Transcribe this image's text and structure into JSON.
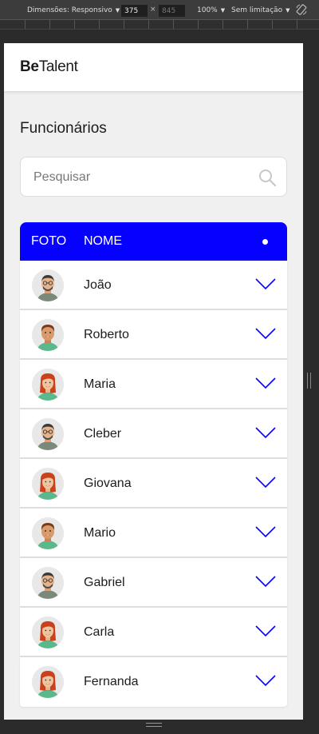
{
  "devtools": {
    "dimensions_label": "Dimensões: Responsivo",
    "width": "375",
    "height_placeholder": "845",
    "times": "×",
    "zoom": "100%",
    "throttle": "Sem limitação"
  },
  "header": {
    "logo_bold": "Be",
    "logo_regular": "Talent"
  },
  "page": {
    "title": "Funcionários"
  },
  "search": {
    "placeholder": "Pesquisar"
  },
  "table": {
    "col_foto": "FOTO",
    "col_nome": "NOME",
    "accent_color": "#0500ff",
    "rows": [
      {
        "name": "João",
        "avatar": "man-glasses"
      },
      {
        "name": "Roberto",
        "avatar": "man-young"
      },
      {
        "name": "Maria",
        "avatar": "woman-redhead"
      },
      {
        "name": "Cleber",
        "avatar": "man-glasses"
      },
      {
        "name": "Giovana",
        "avatar": "woman-redhead"
      },
      {
        "name": "Mario",
        "avatar": "man-young"
      },
      {
        "name": "Gabriel",
        "avatar": "man-glasses"
      },
      {
        "name": "Carla",
        "avatar": "woman-redhead"
      },
      {
        "name": "Fernanda",
        "avatar": "woman-redhead"
      }
    ]
  }
}
